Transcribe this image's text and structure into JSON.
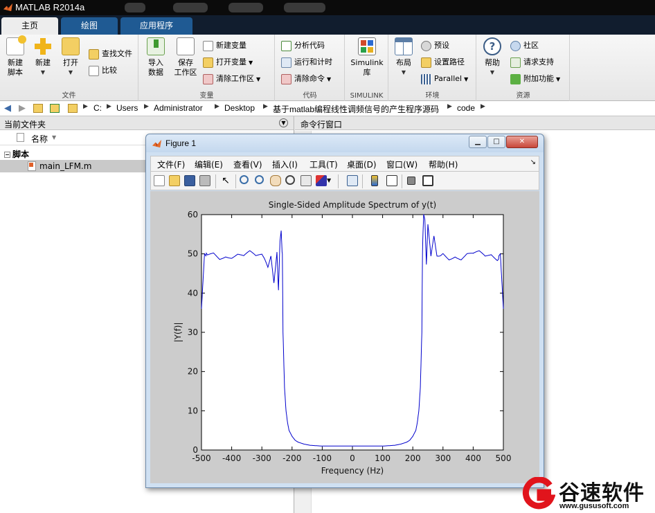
{
  "app": {
    "title": "MATLAB R2014a"
  },
  "tabs": [
    {
      "label": "主页",
      "active": true
    },
    {
      "label": "绘图",
      "active": false
    },
    {
      "label": "应用程序",
      "active": false
    }
  ],
  "ribbon": {
    "file": {
      "label": "文件",
      "new_script": "新建\n脚本",
      "new": "新建",
      "open": "打开",
      "find_files": "查找文件",
      "compare": "比较"
    },
    "variable": {
      "label": "变量",
      "import_data": "导入\n数据",
      "save_workspace": "保存\n工作区",
      "new_variable": "新建变量",
      "open_variable": "打开变量",
      "clear_workspace": "清除工作区"
    },
    "code": {
      "label": "代码",
      "analyze_code": "分析代码",
      "run_and_time": "运行和计时",
      "clear_commands": "清除命令"
    },
    "simulink": {
      "label": "SIMULINK",
      "simulink_library": "Simulink\n库"
    },
    "environment": {
      "label": "环境",
      "layout": "布局",
      "preferences": "预设",
      "set_path": "设置路径",
      "parallel": "Parallel"
    },
    "resources": {
      "label": "资源",
      "help": "帮助",
      "community": "社区",
      "request_support": "请求支持",
      "addons": "附加功能"
    }
  },
  "path": [
    "C:",
    "Users",
    "Administrator",
    "Desktop",
    "基于matlab编程线性调频信号的产生程序源码",
    "code"
  ],
  "current_folder": {
    "title": "当前文件夹",
    "column_name": "名称",
    "group": "脚本",
    "files": [
      "main_LFM.m"
    ]
  },
  "command_window": {
    "title": "命令行窗口"
  },
  "figure": {
    "title": "Figure 1",
    "menu": [
      "文件(F)",
      "编辑(E)",
      "查看(V)",
      "插入(I)",
      "工具(T)",
      "桌面(D)",
      "窗口(W)",
      "帮助(H)"
    ]
  },
  "chart_data": {
    "type": "line",
    "title": "Single-Sided Amplitude Spectrum of y(t)",
    "xlabel": "Frequency (Hz)",
    "ylabel": "|Y(f)|",
    "xlim": [
      -500,
      500
    ],
    "ylim": [
      0,
      60
    ],
    "xticks": [
      -500,
      -400,
      -300,
      -200,
      -100,
      0,
      100,
      200,
      300,
      400,
      500
    ],
    "yticks": [
      0,
      10,
      20,
      30,
      40,
      50,
      60
    ],
    "grid": false,
    "color": "#0000cc",
    "series": [
      {
        "x": [
          -500,
          -495,
          -490,
          -480,
          -460,
          -440,
          -420,
          -400,
          -380,
          -360,
          -340,
          -320,
          -300,
          -280,
          -270,
          -260,
          -250,
          -245,
          -240,
          -236,
          -232,
          -230,
          -225,
          -220,
          -215,
          -210,
          -200,
          -190,
          -180,
          -160,
          -140,
          -120,
          -100,
          -50,
          0,
          50,
          100,
          120,
          140,
          160,
          180,
          190,
          200,
          210,
          215,
          220,
          225,
          230,
          232,
          236,
          240,
          245,
          250,
          260,
          270,
          280,
          300,
          320,
          340,
          360,
          380,
          400,
          420,
          440,
          460,
          480,
          490,
          495,
          500
        ],
        "y": [
          36,
          43,
          50,
          49,
          50,
          49,
          50,
          49.5,
          50,
          49,
          50,
          49,
          50,
          48,
          52,
          46,
          54,
          44,
          56,
          58,
          50,
          30,
          16,
          10,
          7,
          5,
          3.5,
          2.5,
          2,
          1.5,
          1.2,
          1.1,
          1,
          1,
          1,
          1,
          1,
          1.1,
          1.2,
          1.5,
          2,
          2.5,
          3.5,
          5,
          7,
          10,
          16,
          30,
          50,
          58,
          56,
          44,
          54,
          46,
          52,
          48,
          50,
          49,
          50,
          49,
          50,
          49.5,
          50,
          49,
          50,
          49,
          50,
          43,
          36
        ]
      }
    ]
  },
  "watermark": {
    "text": "谷速软件",
    "url": "www.gususoft.com"
  }
}
